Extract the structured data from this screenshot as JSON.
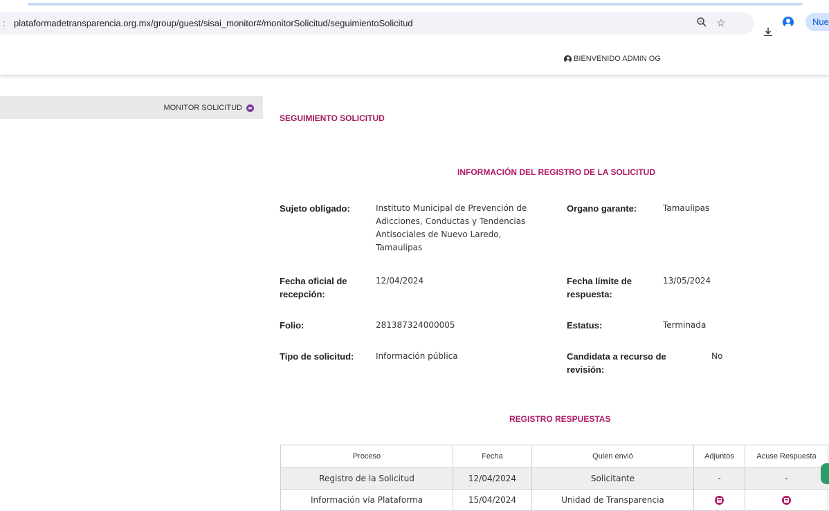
{
  "browser": {
    "edge_char": ":",
    "url": "plataformadetransparencia.org.mx/group/guest/sisai_monitor#/monitorSolicitud/seguimientoSolicitud",
    "new_button_label": "Nuev"
  },
  "header": {
    "welcome": "BIENVENIDO ADMIN OG"
  },
  "sidebar": {
    "items": [
      {
        "label": "MONITOR SOLICITUD"
      }
    ]
  },
  "main": {
    "page_title": "SEGUIMIENTO SOLICITUD",
    "info_title": "INFORMACIÓN DEL REGISTRO DE LA SOLICITUD",
    "fields": {
      "sujeto_label": "Sujeto obligado:",
      "sujeto_value": "Instituto Municipal de Prevención de Adicciones, Conductas y Tendencias Antisociales de Nuevo Laredo, Tamaulipas",
      "organo_label": "Organo garante:",
      "organo_value": "Tamaulipas",
      "fecha_oficial_label": "Fecha oficial de recepción:",
      "fecha_oficial_value": "12/04/2024",
      "fecha_limite_label": "Fecha límite de respuesta:",
      "fecha_limite_value": "13/05/2024",
      "folio_label": "Folio:",
      "folio_value": "281387324000005",
      "estatus_label": "Estatus:",
      "estatus_value": "Terminada",
      "tipo_label": "Tipo de solicitud:",
      "tipo_value": "Información pública",
      "candidata_label": "Candidata a recurso de revisión:",
      "candidata_value": "No"
    },
    "responses_title": "REGISTRO RESPUESTAS",
    "table": {
      "headers": [
        "Proceso",
        "Fecha",
        "Quien envió",
        "Adjuntos",
        "Acuse Respuesta"
      ],
      "rows": [
        {
          "proceso": "Registro de la Solicitud",
          "fecha": "12/04/2024",
          "quien": "Solicitante",
          "adjuntos": "-",
          "acuse": "-"
        },
        {
          "proceso": "Información vía Plataforma",
          "fecha": "15/04/2024",
          "quien": "Unidad de Transparencia",
          "adjuntos_icon": "document-icon",
          "acuse_icon": "document-icon"
        }
      ]
    }
  },
  "colors": {
    "accent": "#b01a67",
    "sidebar_bg": "#e8e8e8",
    "sidebar_dot": "#7b3f9e"
  }
}
